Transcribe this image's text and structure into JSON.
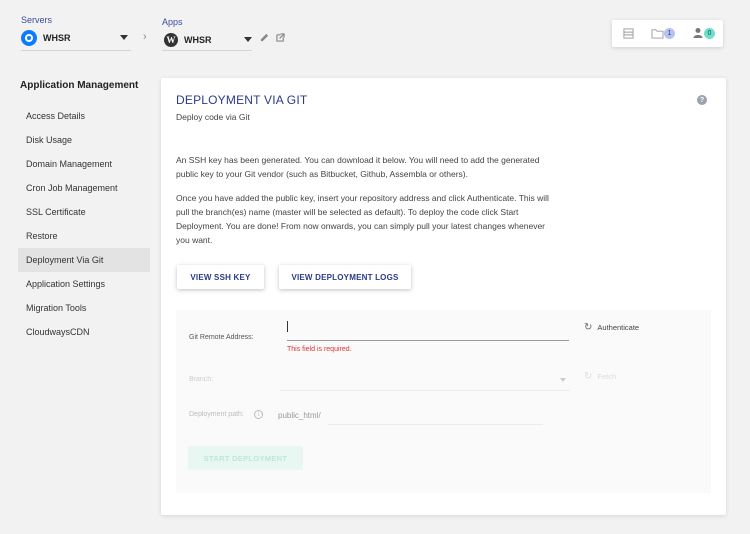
{
  "header": {
    "servers_label": "Servers",
    "server_name": "WHSR",
    "apps_label": "Apps",
    "app_name": "WHSR",
    "notifications_count": "1",
    "users_count": "0"
  },
  "sidebar": {
    "title": "Application Management",
    "items": [
      {
        "label": "Access Details"
      },
      {
        "label": "Disk Usage"
      },
      {
        "label": "Domain Management"
      },
      {
        "label": "Cron Job Management"
      },
      {
        "label": "SSL Certificate"
      },
      {
        "label": "Restore"
      },
      {
        "label": "Deployment Via Git"
      },
      {
        "label": "Application Settings"
      },
      {
        "label": "Migration Tools"
      },
      {
        "label": "CloudwaysCDN"
      }
    ],
    "active_index": 6
  },
  "panel": {
    "title": "DEPLOYMENT VIA GIT",
    "subtitle": "Deploy code via Git",
    "para1": "An SSH key has been generated. You can download it below. You will need to add the generated public key to your Git vendor (such as Bitbucket, Github, Assembla or others).",
    "para2": "Once you have added the public key, insert your repository address and click Authenticate. This will pull the branch(es) name (master will be selected as default). To deploy the code click Start Deployment. You are done! From now onwards, you can simply pull your latest changes whenever you want.",
    "view_ssh_key": "VIEW SSH KEY",
    "view_logs": "VIEW DEPLOYMENT LOGS"
  },
  "form": {
    "git_remote_label": "Git Remote Address:",
    "git_remote_value": "",
    "git_remote_error": "This field is required.",
    "authenticate_label": "Authenticate",
    "branch_label": "Branch:",
    "branch_value": "",
    "refresh_label": "Fetch",
    "deploy_path_label": "Deployment path:",
    "deploy_path_value": "public_html/",
    "start_deployment": "START DEPLOYMENT"
  },
  "colors": {
    "accent": "#2b3a8c",
    "error": "#dd3333",
    "badge_blue": "#b8c2f0",
    "badge_green": "#6fe0c4",
    "disabled_green": "#e8f7f1"
  }
}
